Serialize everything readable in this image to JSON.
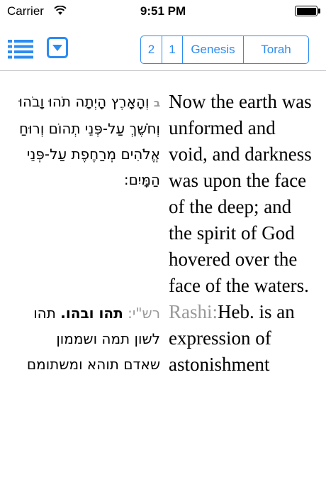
{
  "status": {
    "carrier": "Carrier",
    "time": "9:51 PM"
  },
  "nav": {
    "chapter": "2",
    "verse": "1",
    "book": "Genesis",
    "section": "Torah"
  },
  "verse": {
    "number": "ב",
    "hebrew": "וְהָאָרֶץ הָיְתָה תֹהוּ וָבֹהוּ וְחֹשֶׁךְ עַל-פְּנֵי תְהוֹם וְרוּחַ אֱלֹהִים מְרַחֶפֶת עַל-פְּנֵי הַמָּיִם:",
    "english": "Now the earth was unformed and void, and darkness was upon the face of the deep; and the spirit of God hovered over the face of the waters."
  },
  "rashi": {
    "label_hebrew": "רש\"י:",
    "heading_hebrew": "תהו ובהו.",
    "text_hebrew": "תהו לשון תמה ושממון שאדם תוהא ומשתומם",
    "label_english": "Rashi:",
    "text_english": "Heb. is an expression of astonishment"
  }
}
